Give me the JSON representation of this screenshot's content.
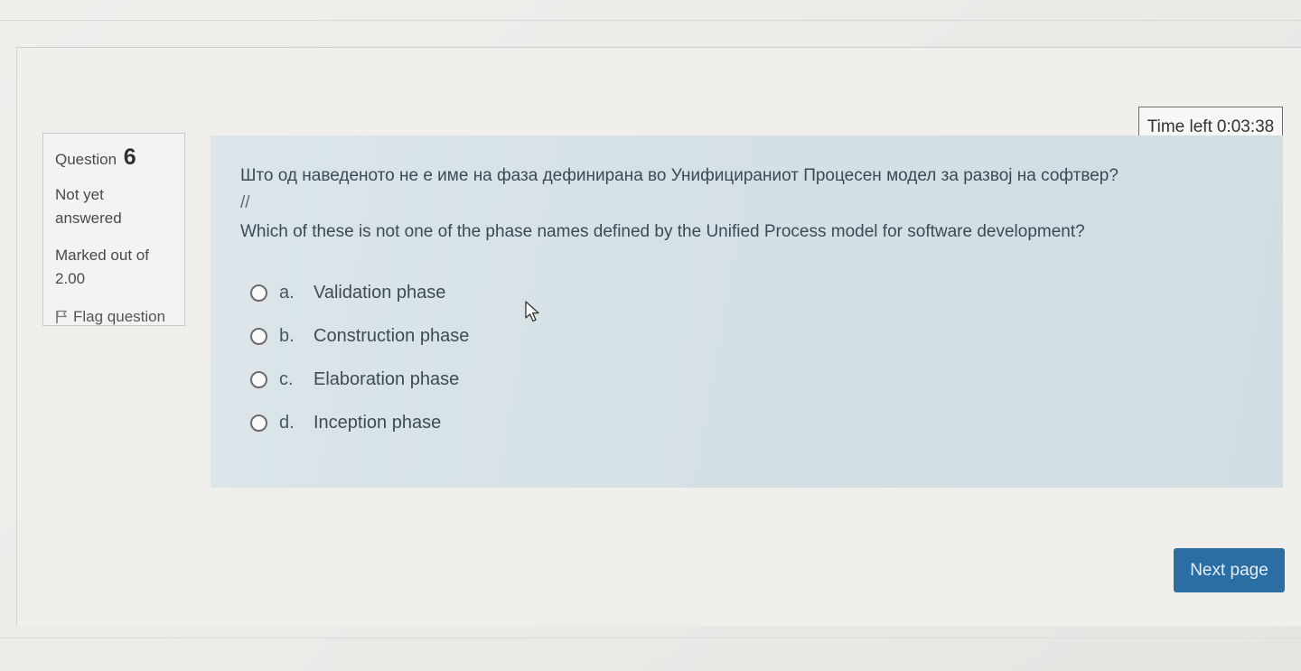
{
  "timer": {
    "label": "Time left",
    "value": "0:03:38"
  },
  "question_info": {
    "question_label": "Question",
    "question_number": "6",
    "state": "Not yet answered",
    "grade_label": "Marked out of",
    "grade_value": "2.00",
    "flag_label": "Flag question",
    "flag_icon": "flag-icon"
  },
  "question": {
    "text_mk": "Што од наведеното не е име на фаза дефинирана во Унифицираниот Процесен модел за развој на софтвер?",
    "separator": "//",
    "text_en": "Which of these is not one of the phase names defined by the Unified Process model for software development?"
  },
  "answers": [
    {
      "letter": "a.",
      "text": "Validation phase"
    },
    {
      "letter": "b.",
      "text": "Construction phase"
    },
    {
      "letter": "c.",
      "text": "Elaboration phase"
    },
    {
      "letter": "d.",
      "text": "Inception phase"
    }
  ],
  "navigation": {
    "next_label": "Next page"
  },
  "colors": {
    "accent": "#2b6ea3",
    "content_background": "#d6e1e6"
  }
}
